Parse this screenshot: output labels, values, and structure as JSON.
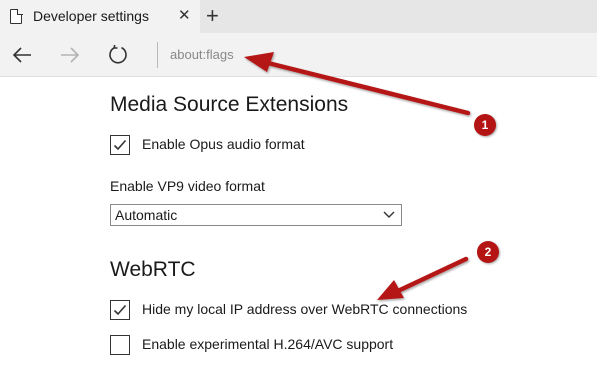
{
  "tab": {
    "title": "Developer settings",
    "close": "✕",
    "new_tab": "+"
  },
  "navbar": {
    "address": "about:flags"
  },
  "media_source": {
    "title": "Media Source Extensions",
    "opus_label": "Enable Opus audio format",
    "opus_checked": true,
    "vp9_label": "Enable VP9 video format",
    "vp9_value": "Automatic"
  },
  "webrtc": {
    "title": "WebRTC",
    "hide_ip_label": "Hide my local IP address over WebRTC connections",
    "hide_ip_checked": true,
    "h264_label": "Enable experimental H.264/AVC support",
    "h264_checked": false
  },
  "annotations": {
    "badge1": "1",
    "badge2": "2",
    "color": "#b51414"
  },
  "icons": {
    "back": "arrow-left-icon",
    "forward": "arrow-right-icon",
    "refresh": "refresh-icon",
    "favicon": "document-icon",
    "checkmark": "checkmark-icon",
    "dropdown": "chevron-down-icon"
  }
}
